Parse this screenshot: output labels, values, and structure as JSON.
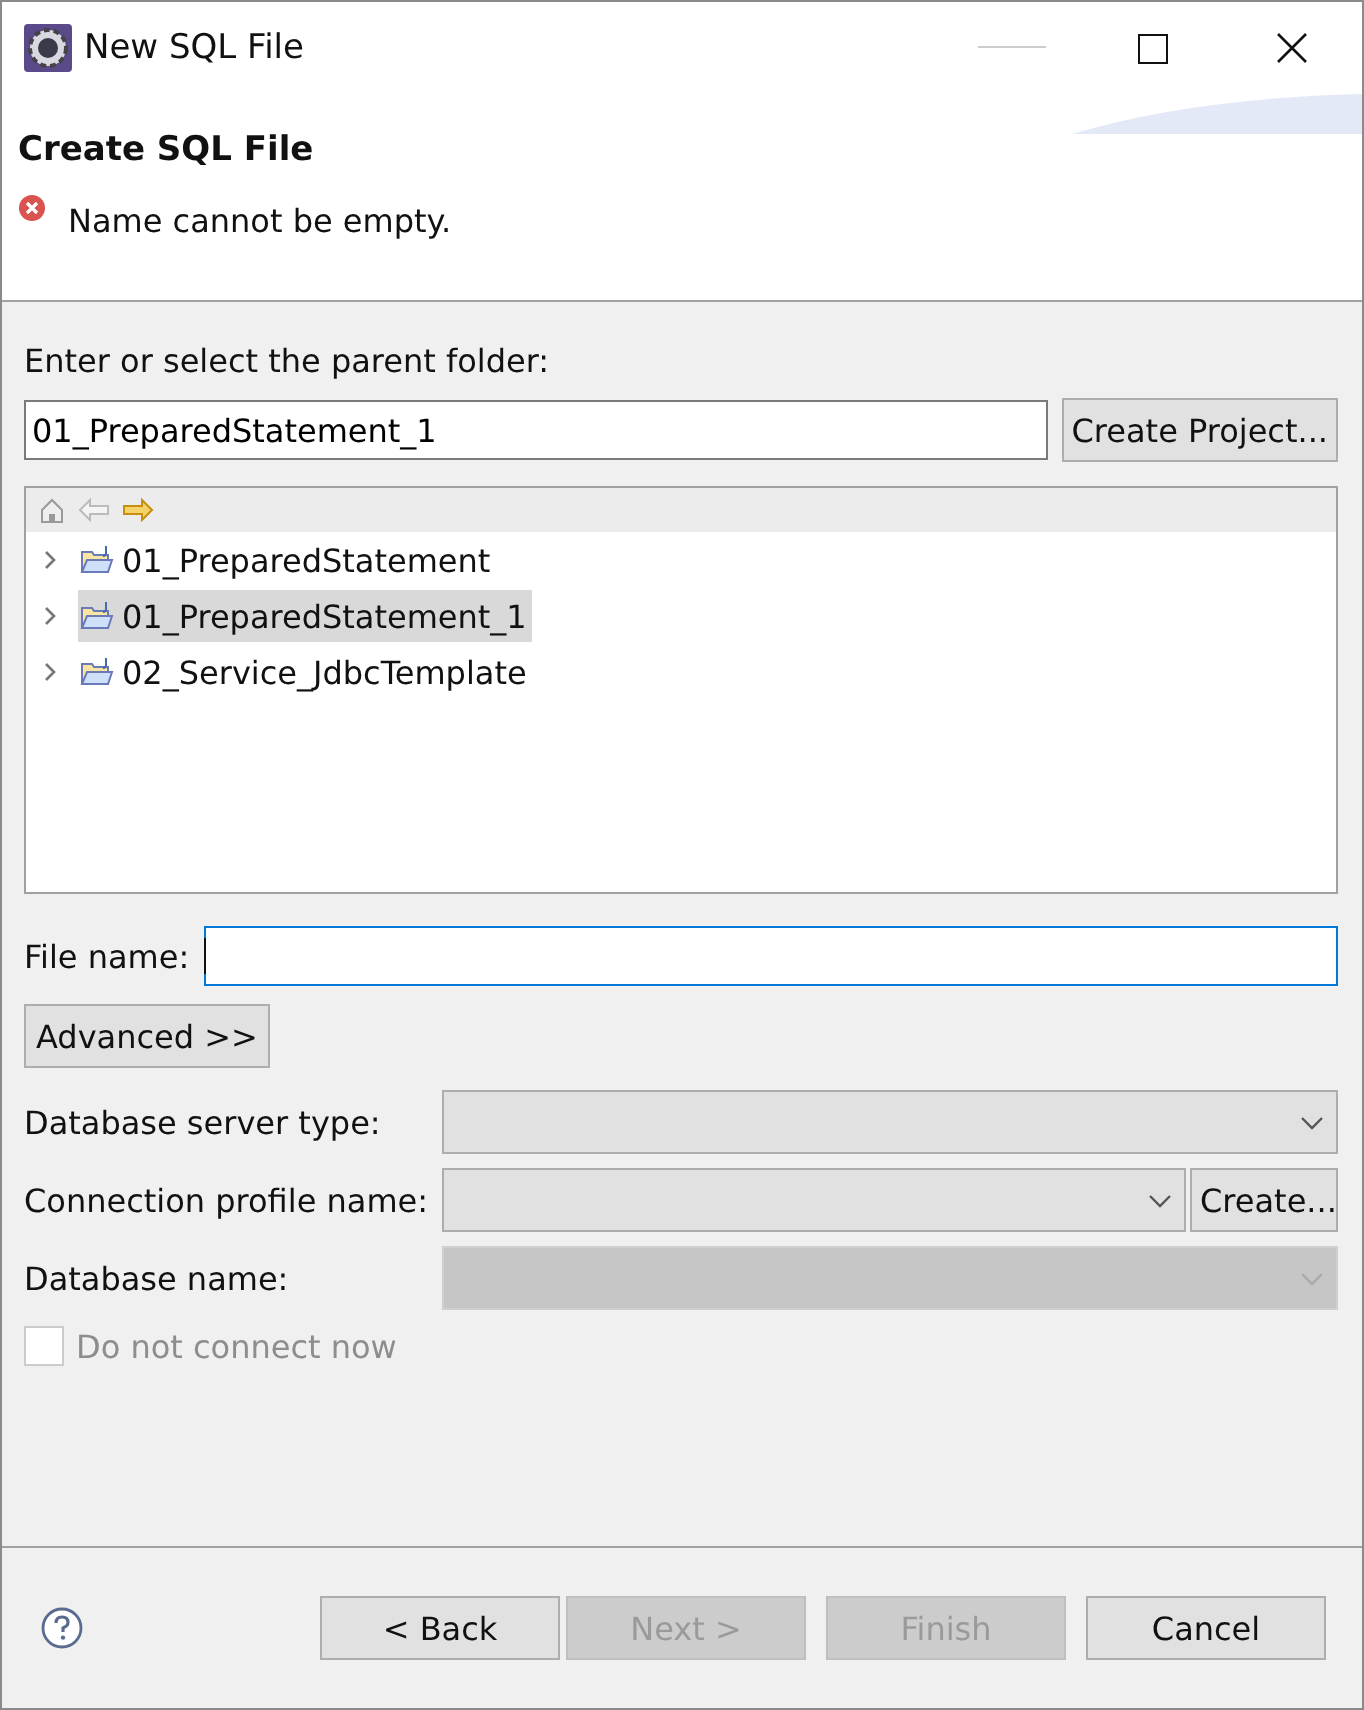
{
  "window": {
    "title": "New SQL File"
  },
  "header": {
    "title": "Create SQL File",
    "message": "Name cannot be empty."
  },
  "parent_folder": {
    "label": "Enter or select the parent folder:",
    "value": "01_PreparedStatement_1",
    "button": {
      "label": "Create Project...",
      "disabled": false
    }
  },
  "tree": {
    "items": [
      {
        "label": "01_PreparedStatement",
        "selected": false
      },
      {
        "label": "01_PreparedStatement_1",
        "selected": true
      },
      {
        "label": "02_Service_JdbcTemplate",
        "selected": false
      }
    ]
  },
  "file_name": {
    "label": "File name:",
    "focused": true
  },
  "advanced_button": {
    "label": "Advanced >>"
  },
  "fields": [
    {
      "label": "Database server type:",
      "disabled": false
    },
    {
      "label": "Connection profile name:",
      "disabled": false,
      "button": {
        "label": "Create..."
      }
    },
    {
      "label": "Database name:",
      "disabled": true
    }
  ],
  "do_not_connect": {
    "label": "Do not connect now",
    "checked": false,
    "disabled": true
  },
  "buttons": [
    {
      "label": "< Back",
      "disabled": false
    },
    {
      "label": "Next >",
      "disabled": true
    },
    {
      "label": "Finish",
      "disabled": true
    },
    {
      "label": "Cancel",
      "disabled": false
    }
  ]
}
